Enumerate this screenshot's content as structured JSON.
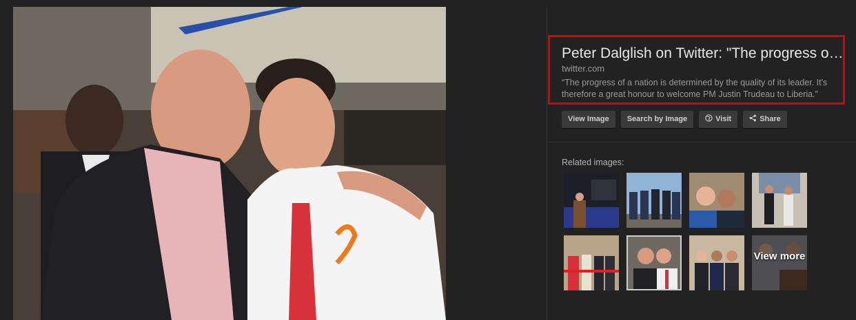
{
  "result": {
    "title": "Peter Dalglish on Twitter: \"The progress of a nation is determined by the quality of its leader\"",
    "domain": "twitter.com",
    "description": "“The progress of a nation is determined by the quality of its leader. It's therefore a great honour to welcome PM Justin Trudeau to Liberia.”"
  },
  "buttons": {
    "view_image": "View Image",
    "search_by_image": "Search by Image",
    "visit": "Visit",
    "share": "Share"
  },
  "related": {
    "label": "Related images:",
    "view_more": "View more"
  },
  "icons": {
    "visit": "globe-icon",
    "share": "share-icon"
  },
  "colors": {
    "background": "#222222",
    "highlight_border": "#e00000",
    "button_bg": "#3a3a3a"
  }
}
